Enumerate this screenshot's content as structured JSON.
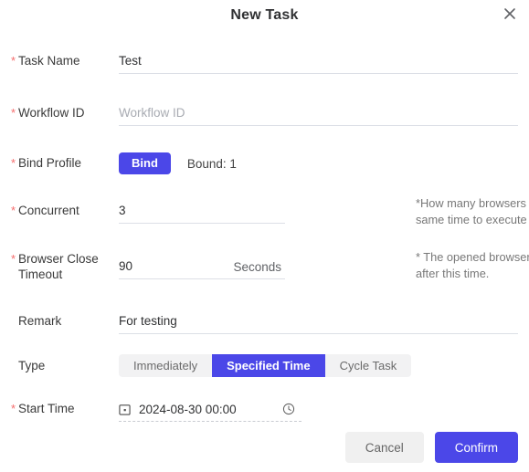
{
  "dialog": {
    "title": "New Task",
    "close_icon": "close-icon"
  },
  "fields": {
    "task_name": {
      "label": "Task Name",
      "required_mark": "*",
      "value": "Test"
    },
    "workflow_id": {
      "label": "Workflow ID",
      "required_mark": "*",
      "value": "",
      "placeholder": "Workflow ID"
    },
    "bind_profile": {
      "label": "Bind Profile",
      "required_mark": "*",
      "button_label": "Bind",
      "bound_text": "Bound: 1"
    },
    "concurrent": {
      "label": "Concurrent",
      "required_mark": "*",
      "value": "3",
      "hint": "*How many browsers are open at the same time to execute the RPA task."
    },
    "browser_close_timeout": {
      "label": "Browser Close Timeout",
      "required_mark": "*",
      "value": "90",
      "suffix": "Seconds",
      "hint": "* The opened browsers will auto close after this time."
    },
    "remark": {
      "label": "Remark",
      "value": "For testing"
    },
    "type": {
      "label": "Type",
      "options": [
        "Immediately",
        "Specified Time",
        "Cycle Task"
      ],
      "selected": "Specified Time"
    },
    "start_time": {
      "label": "Start Time",
      "required_mark": "*",
      "value": "2024-08-30 00:00",
      "calendar_icon": "calendar-icon",
      "clock_icon": "clock-icon"
    }
  },
  "footer": {
    "cancel_label": "Cancel",
    "confirm_label": "Confirm"
  },
  "colors": {
    "accent": "#4b47e8",
    "required": "#f56c6c",
    "cancel_bg": "#f0f0f0",
    "segment_bg": "#f2f2f3"
  }
}
